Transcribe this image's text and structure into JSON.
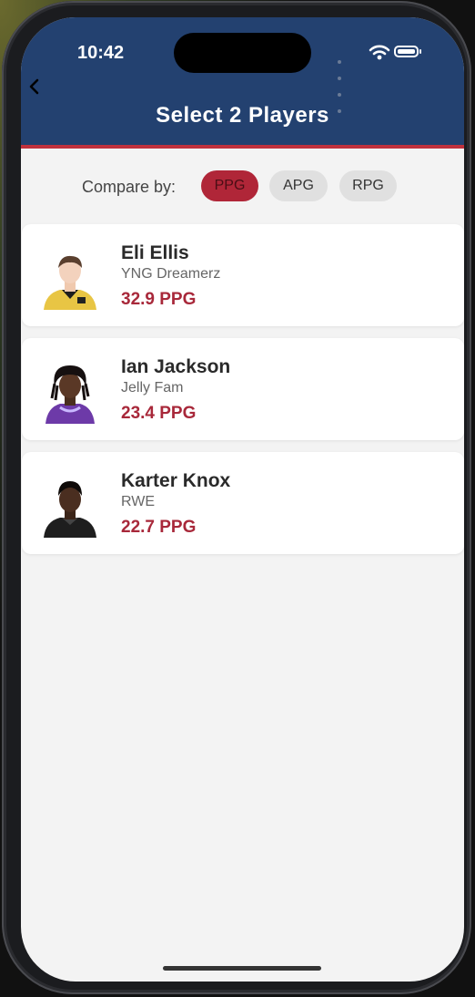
{
  "status_bar": {
    "time": "10:42"
  },
  "header": {
    "title": "Select 2 Players"
  },
  "compare": {
    "label": "Compare by:",
    "options": [
      "PPG",
      "APG",
      "RPG"
    ],
    "selected": "PPG"
  },
  "players": [
    {
      "name": "Eli Ellis",
      "team": "YNG Dreamerz",
      "stat": "32.9 PPG"
    },
    {
      "name": "Ian Jackson",
      "team": "Jelly Fam",
      "stat": "23.4 PPG"
    },
    {
      "name": "Karter Knox",
      "team": "RWE",
      "stat": "22.7 PPG"
    }
  ],
  "colors": {
    "header_bg": "#234170",
    "accent_red": "#b02638",
    "stat_red": "#a8283a"
  }
}
